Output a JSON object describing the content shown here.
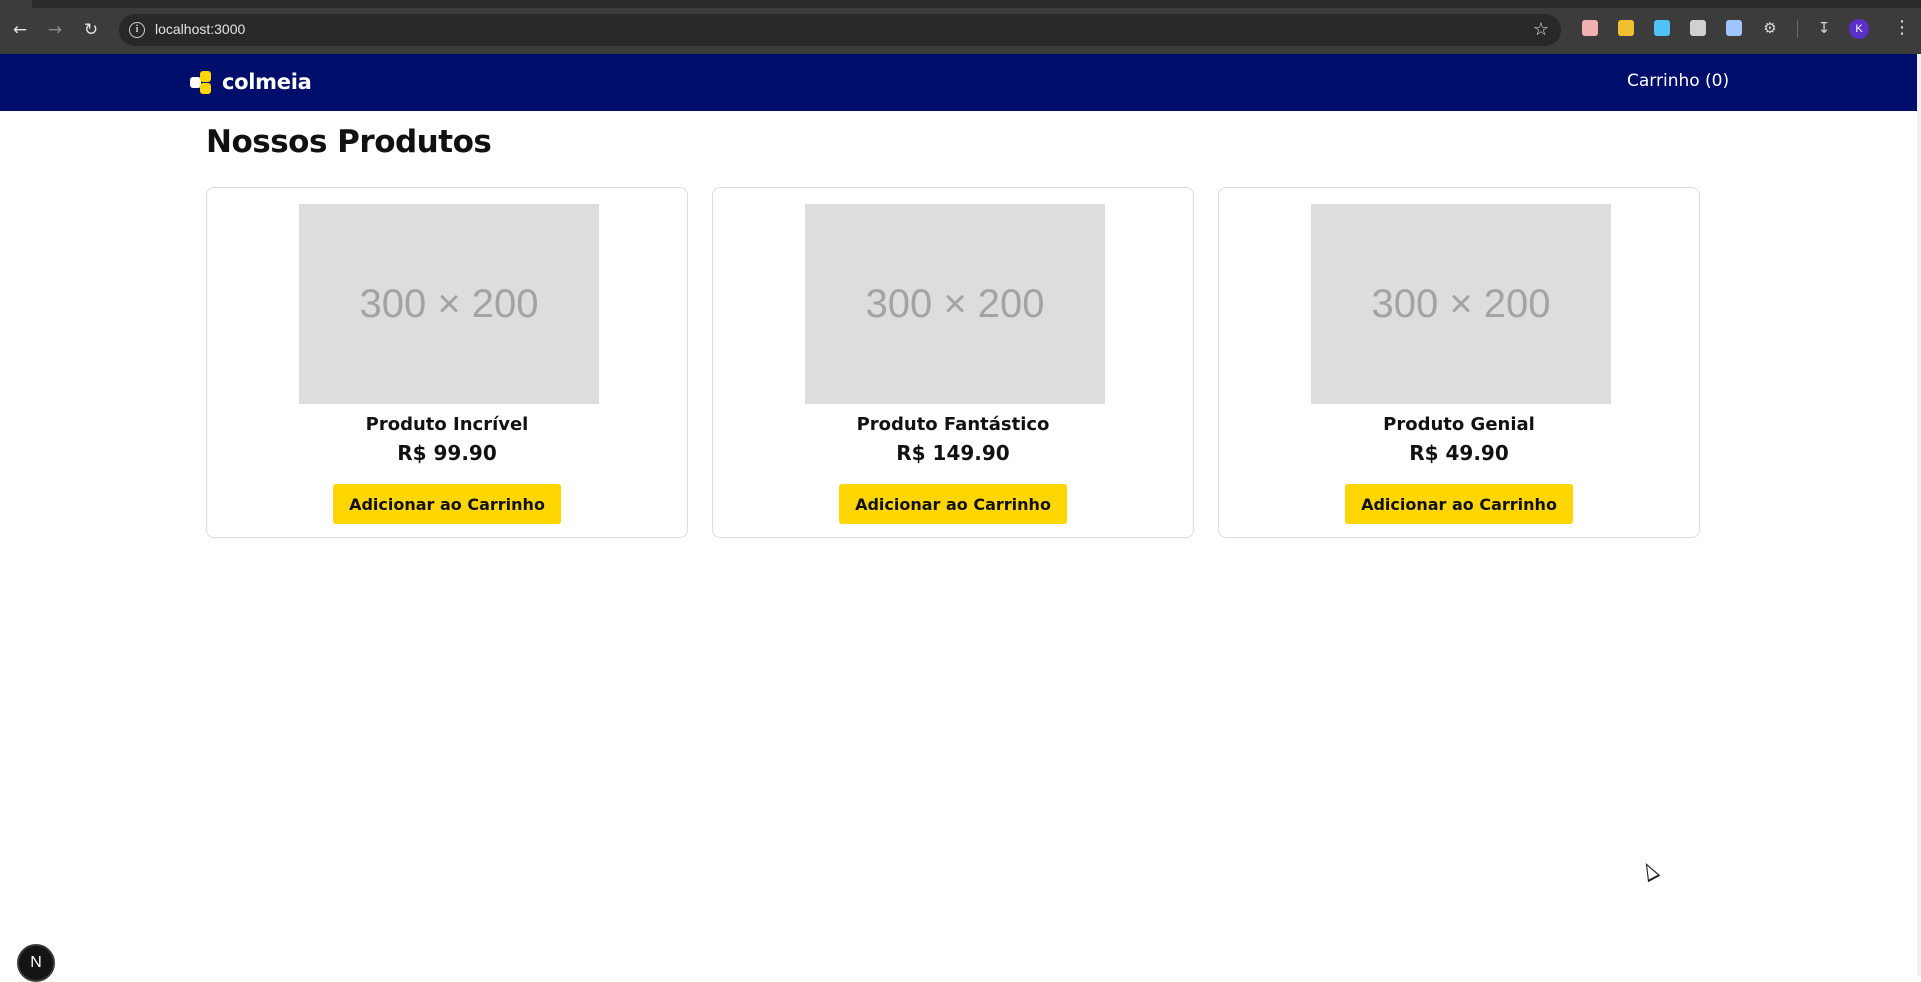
{
  "browser": {
    "url": "localhost:3000",
    "profile_initial": "K",
    "extension_colors": [
      "#f3b0b0",
      "#f0c030",
      "#4fc3f7",
      "#d0d0d0",
      "#9ec5ff"
    ]
  },
  "header": {
    "brand": "colmeia",
    "cart_label": "Carrinho (0)",
    "bg_color": "#000e6b",
    "logo_colors": [
      "#ffffff",
      "#ffd600",
      "#ffd600"
    ]
  },
  "main": {
    "title": "Nossos Produtos",
    "products": [
      {
        "image_text": "300 × 200",
        "name": "Produto Incrível",
        "price": "R$ 99.90",
        "button": "Adicionar ao Carrinho"
      },
      {
        "image_text": "300 × 200",
        "name": "Produto Fantástico",
        "price": "R$ 149.90",
        "button": "Adicionar ao Carrinho"
      },
      {
        "image_text": "300 × 200",
        "name": "Produto Genial",
        "price": "R$ 49.90",
        "button": "Adicionar ao Carrinho"
      }
    ],
    "accent_color": "#ffd600"
  },
  "dev": {
    "next_badge": "N"
  }
}
